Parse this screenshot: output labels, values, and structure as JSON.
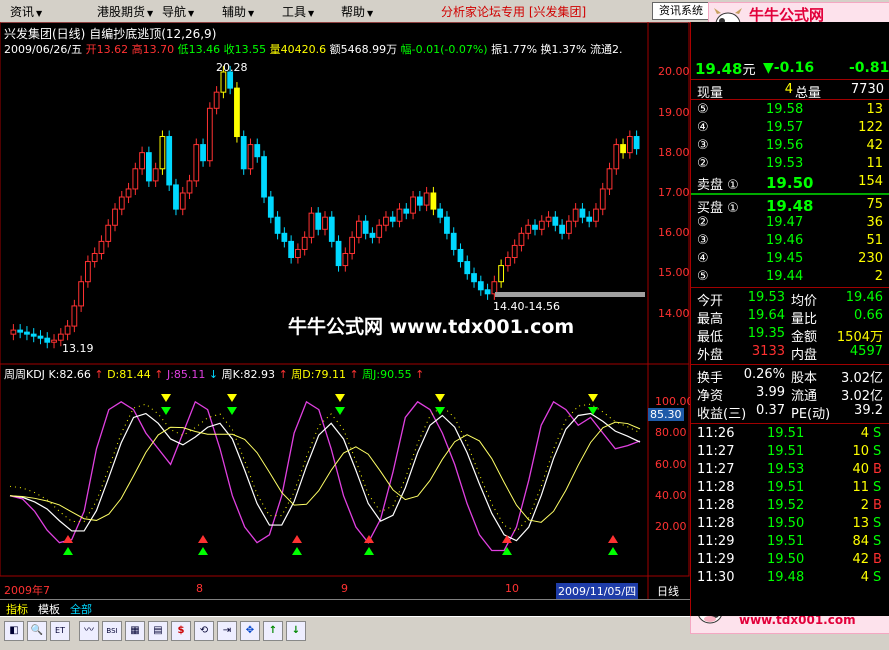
{
  "menu": {
    "items": [
      {
        "label": "资讯",
        "has_arrow": true
      },
      {
        "label": "港股期货",
        "has_arrow": true
      },
      {
        "label": "导航",
        "has_arrow": true
      },
      {
        "label": "辅助",
        "has_arrow": true
      },
      {
        "label": "工具",
        "has_arrow": true
      },
      {
        "label": "帮助",
        "has_arrow": true
      }
    ],
    "center_title": "分析家论坛专用 [兴发集团]",
    "info_button": "资讯系统"
  },
  "logo": {
    "name": "牛牛公式网",
    "url": "www.tdx001.com"
  },
  "chart": {
    "stock_line": "兴发集团(日线)",
    "indicator_name": "自编抄底逃顶(12,26,9)",
    "quote_line": {
      "date": "2009/06/26/五",
      "open_label": "开",
      "open": "13.62",
      "high_label": "高",
      "high": "13.70",
      "low_label": "低",
      "low": "13.46",
      "close_label": "收",
      "close": "13.55",
      "volume_label": "量",
      "volume": "40420.6",
      "amount_label": "额",
      "amount": "5468.99万",
      "change_label": "幅",
      "change": "-0.01(-0.07%)",
      "amplitude": "振1.77%",
      "turnover": "换1.37%",
      "float": "流通2."
    },
    "price_axis": [
      "20.00",
      "19.00",
      "18.00",
      "17.00",
      "16.00",
      "15.00",
      "14.00"
    ],
    "annotations": {
      "high": "20.28",
      "low": "13.19",
      "range": "14.40-14.56"
    },
    "watermark": "牛牛公式网 www.tdx001.com",
    "kdj_line": {
      "name": "周周KDJ",
      "k": "K:82.66",
      "d": "D:81.44",
      "j": "J:85.11",
      "wk": "周K:82.93",
      "wd": "周D:79.11",
      "wj": "周J:90.55"
    },
    "kdj_axis": [
      "100.00",
      "80.00",
      "60.00",
      "40.00",
      "20.00"
    ],
    "kdj_current": "85.30",
    "date_axis": [
      "2009年7",
      "8",
      "9",
      "10"
    ],
    "cursor_date": "2009/11/05/四",
    "period_button": "日线"
  },
  "tabs": [
    "指标",
    "模板",
    "全部"
  ],
  "toolbar": [
    "◧",
    "🔍",
    "ET",
    "〰",
    "BSI",
    "▦",
    "▤",
    "$",
    "⟲",
    "⇥",
    "✥",
    "↑",
    "↓"
  ],
  "colors": {
    "up": "#ff3232",
    "down": "#00d8ff",
    "yellow": "#ffff00",
    "green": "#00ff00",
    "magenta": "#e040e0",
    "panel_red": "#ff3030"
  },
  "panel": {
    "last_price": "19.48",
    "last_unit": "元",
    "change": "▼-0.16",
    "change_pct": "-0.81",
    "now_label": "现量",
    "now_vol": "4",
    "total_label": "总量",
    "total_vol": "7730",
    "sell_levels": [
      {
        "label": "⑤",
        "price": "19.58",
        "vol": "13"
      },
      {
        "label": "④",
        "price": "19.57",
        "vol": "122"
      },
      {
        "label": "③",
        "price": "19.56",
        "vol": "42"
      },
      {
        "label": "②",
        "price": "19.53",
        "vol": "11"
      },
      {
        "label": "卖盘 ①",
        "price": "19.50",
        "vol": "154"
      }
    ],
    "buy_levels": [
      {
        "label": "买盘 ①",
        "price": "19.48",
        "vol": "75"
      },
      {
        "label": "②",
        "price": "19.47",
        "vol": "36"
      },
      {
        "label": "③",
        "price": "19.46",
        "vol": "51"
      },
      {
        "label": "④",
        "price": "19.45",
        "vol": "230"
      },
      {
        "label": "⑤",
        "price": "19.44",
        "vol": "2"
      }
    ],
    "stats": [
      {
        "l1": "今开",
        "v1": "19.53",
        "l2": "均价",
        "v2": "19.46"
      },
      {
        "l1": "最高",
        "v1": "19.64",
        "l2": "量比",
        "v2": "0.66"
      },
      {
        "l1": "最低",
        "v1": "19.35",
        "l2": "金额",
        "v2": "1504万"
      },
      {
        "l1": "外盘",
        "v1": "3133",
        "l2": "内盘",
        "v2": "4597"
      }
    ],
    "stats2": [
      {
        "l1": "换手",
        "v1": "0.26%",
        "l2": "股本",
        "v2": "3.02亿"
      },
      {
        "l1": "净资",
        "v1": "3.99",
        "l2": "流通",
        "v2": "3.02亿"
      },
      {
        "l1": "收益(三)",
        "v1": "0.37",
        "l2": "PE(动)",
        "v2": "39.2"
      }
    ],
    "ticks": [
      {
        "t": "11:26",
        "p": "19.51",
        "v": "4",
        "s": "S"
      },
      {
        "t": "11:27",
        "p": "19.51",
        "v": "10",
        "s": "S"
      },
      {
        "t": "11:27",
        "p": "19.53",
        "v": "40",
        "s": "B"
      },
      {
        "t": "11:28",
        "p": "19.51",
        "v": "11",
        "s": "S"
      },
      {
        "t": "11:28",
        "p": "19.52",
        "v": "2",
        "s": "B"
      },
      {
        "t": "11:28",
        "p": "19.50",
        "v": "13",
        "s": "S"
      },
      {
        "t": "11:29",
        "p": "19.51",
        "v": "84",
        "s": "S"
      },
      {
        "t": "11:29",
        "p": "19.50",
        "v": "42",
        "s": "B"
      },
      {
        "t": "11:30",
        "p": "19.48",
        "v": "4",
        "s": "S"
      }
    ]
  }
}
